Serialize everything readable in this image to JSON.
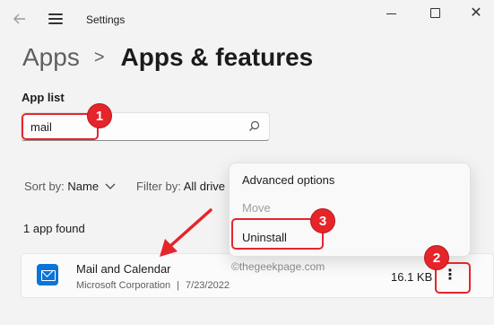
{
  "titlebar": {
    "title": "Settings",
    "back_icon": "back-arrow-icon",
    "menu_icon": "hamburger-icon",
    "minimize_icon": "minimize-icon",
    "maximize_icon": "maximize-icon",
    "close_icon": "close-icon"
  },
  "breadcrumb": {
    "parent": "Apps",
    "separator": ">",
    "current": "Apps & features"
  },
  "app_list": {
    "label": "App list",
    "search_value": "mail",
    "search_icon": "search-icon"
  },
  "filters": {
    "sort_label": "Sort by:",
    "sort_value": "Name",
    "sort_chevron": "⌵",
    "filter_label": "Filter by:",
    "filter_value": "All drive"
  },
  "results": {
    "count_text": "1 app found"
  },
  "app": {
    "name": "Mail and Calendar",
    "publisher": "Microsoft Corporation",
    "separator": "|",
    "date": "7/23/2022",
    "size": "16.1 KB",
    "more_icon": "more-options-icon",
    "icon": "mail-app-icon"
  },
  "context_menu": {
    "items": [
      {
        "label": "Advanced options",
        "enabled": true
      },
      {
        "label": "Move",
        "enabled": false
      },
      {
        "label": "Uninstall",
        "enabled": true
      }
    ]
  },
  "annotations": {
    "step1": "1",
    "step2": "2",
    "step3": "3",
    "color": "#e5252a"
  },
  "watermark": "©thegeekpage.com",
  "colors": {
    "accent": "#0a74d8",
    "background": "#f3f3f3"
  }
}
